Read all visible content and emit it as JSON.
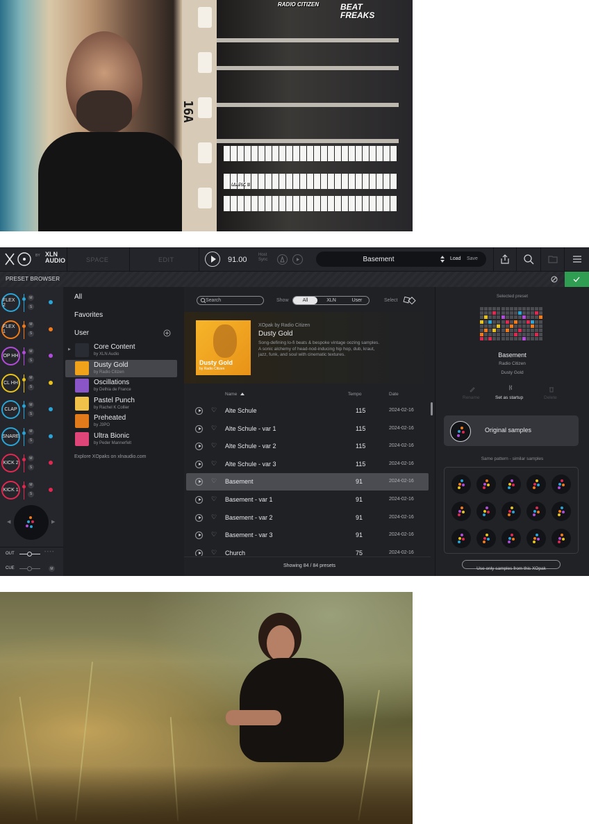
{
  "app": {
    "logo_brand": "XLN\nAUDIO",
    "logo_by": "BY",
    "nav_space": "SPACE",
    "nav_edit": "EDIT",
    "tempo": "91.00",
    "host_sync": "Host\nSync",
    "preset_name": "Basement",
    "load_label": "Load",
    "save_label": "Save",
    "preset_browser_label": "PRESET BROWSER",
    "accent_color": "#2f9e52"
  },
  "pads": [
    {
      "label": "FLEX 2",
      "color": "#2aa3d6"
    },
    {
      "label": "FLEX 1",
      "color": "#f07a1a"
    },
    {
      "label": "OP HH",
      "color": "#b24bd9"
    },
    {
      "label": "CL HH",
      "color": "#e8c21a"
    },
    {
      "label": "CLAP",
      "color": "#2aa3d6"
    },
    {
      "label": "SNARE",
      "color": "#2aa3d6"
    },
    {
      "label": "KICK 2",
      "color": "#e02850"
    },
    {
      "label": "KICK 1",
      "color": "#e02850"
    }
  ],
  "mute_label": "M",
  "solo_label": "S",
  "out_label": "OUT",
  "cue_label": "CUE",
  "library": {
    "all": "All",
    "favorites": "Favorites",
    "user": "User",
    "items": [
      {
        "title": "Core Content",
        "sub": "by XLN Audio",
        "color": "#2a2c33"
      },
      {
        "title": "Dusty Gold",
        "sub": "by Radio Citizen",
        "color": "#f0a21a"
      },
      {
        "title": "Oscillations",
        "sub": "by Delhia de France",
        "color": "#8a56c7"
      },
      {
        "title": "Pastel Punch",
        "sub": "by Rachel K Collier",
        "color": "#f0c24a"
      },
      {
        "title": "Preheated",
        "sub": "by J3PO",
        "color": "#e07a1a"
      },
      {
        "title": "Ultra Bionic",
        "sub": "by Peder Mannerfelt",
        "color": "#e0457a"
      }
    ],
    "explore": "Explore XOpaks on xlnaudio.com"
  },
  "browser": {
    "search_placeholder": "Search",
    "show_label": "Show",
    "filters": [
      "All",
      "XLN",
      "User"
    ],
    "select_label": "Select",
    "pak_by": "XOpak by Radio Citizen",
    "pak_title": "Dusty Gold",
    "pak_desc": "Song-defining lo-fi beats & bespoke vintage oozing samples.\nA sonic alchemy of head-nod-inducing hip hop, dub, kraut,\njazz, funk, and soul with cinematic textures.",
    "cover_title": "Dusty Gold",
    "cover_sub": "by Radio Citizen",
    "col_name": "Name",
    "col_tempo": "Tempo",
    "col_date": "Date",
    "rows": [
      {
        "name": "Alte Schule",
        "tempo": "115",
        "date": "2024-02-16"
      },
      {
        "name": "Alte Schule - var 1",
        "tempo": "115",
        "date": "2024-02-16"
      },
      {
        "name": "Alte Schule - var 2",
        "tempo": "115",
        "date": "2024-02-16"
      },
      {
        "name": "Alte Schule - var 3",
        "tempo": "115",
        "date": "2024-02-16"
      },
      {
        "name": "Basement",
        "tempo": "91",
        "date": "2024-02-16"
      },
      {
        "name": "Basement - var 1",
        "tempo": "91",
        "date": "2024-02-16"
      },
      {
        "name": "Basement - var 2",
        "tempo": "91",
        "date": "2024-02-16"
      },
      {
        "name": "Basement - var 3",
        "tempo": "91",
        "date": "2024-02-16"
      },
      {
        "name": "Church",
        "tempo": "75",
        "date": "2024-02-16"
      }
    ],
    "footer": "Showing 84 / 84 presets"
  },
  "selected": {
    "heading": "Selected preset",
    "name": "Basement",
    "artist": "Radio Citizen",
    "pak": "Dusty Gold",
    "rename": "Rename",
    "startup": "Set as startup",
    "delete": "Delete",
    "original_samples": "Original samples",
    "similar_heading": "Same pattern - similar samples",
    "only_samples": "Use only samples from this XOpak"
  },
  "photo_text": {
    "film_code": "16A",
    "poster1": "RADIO CITIZEN",
    "poster2": "BEAT\nFREAKS",
    "keyboard_label": "MARK II"
  }
}
